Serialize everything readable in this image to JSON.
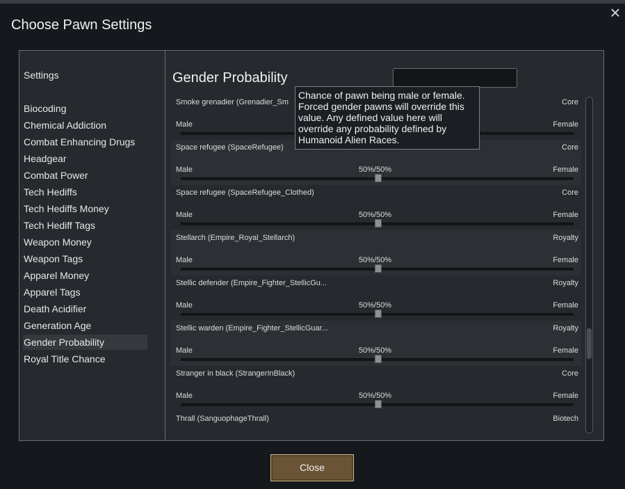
{
  "window": {
    "title": "Choose Pawn Settings",
    "close_icon": "×"
  },
  "sidebar": {
    "items": [
      {
        "label": "Settings"
      },
      {
        "label": "Biocoding"
      },
      {
        "label": "Chemical Addiction"
      },
      {
        "label": "Combat Enhancing Drugs"
      },
      {
        "label": "Headgear"
      },
      {
        "label": "Combat Power"
      },
      {
        "label": "Tech Hediffs"
      },
      {
        "label": "Tech Hediffs Money"
      },
      {
        "label": "Tech Hediff Tags"
      },
      {
        "label": "Weapon Money"
      },
      {
        "label": "Weapon Tags"
      },
      {
        "label": "Apparel Money"
      },
      {
        "label": "Apparel Tags"
      },
      {
        "label": "Death Acidifier"
      },
      {
        "label": "Generation Age"
      },
      {
        "label": "Gender Probability",
        "active": true
      },
      {
        "label": "Royal Title Chance"
      }
    ]
  },
  "main": {
    "title": "Gender Probability",
    "search": {
      "value": "",
      "placeholder": ""
    },
    "rows": [
      {
        "name": "Smoke grenadier (Grenadier_Sm",
        "source": "Core",
        "male": "Male",
        "pct": "",
        "female": "Female",
        "male_share": 0.5
      },
      {
        "name": "Space refugee (SpaceRefugee)",
        "source": "Core",
        "male": "Male",
        "pct": "50%/50%",
        "female": "Female",
        "male_share": 0.5
      },
      {
        "name": "Space refugee (SpaceRefugee_Clothed)",
        "source": "Core",
        "male": "Male",
        "pct": "50%/50%",
        "female": "Female",
        "male_share": 0.5
      },
      {
        "name": "Stellarch (Empire_Royal_Stellarch)",
        "source": "Royalty",
        "male": "Male",
        "pct": "50%/50%",
        "female": "Female",
        "male_share": 0.5
      },
      {
        "name": "Stellic defender (Empire_Fighter_StellicGu...",
        "source": "Royalty",
        "male": "Male",
        "pct": "50%/50%",
        "female": "Female",
        "male_share": 0.5
      },
      {
        "name": "Stellic warden (Empire_Fighter_StellicGuar...",
        "source": "Royalty",
        "male": "Male",
        "pct": "50%/50%",
        "female": "Female",
        "male_share": 0.5
      },
      {
        "name": "Stranger in black (StrangerInBlack)",
        "source": "Core",
        "male": "Male",
        "pct": "50%/50%",
        "female": "Female",
        "male_share": 0.5
      }
    ],
    "last_row": {
      "name": "Thrall (SanguophageThrall)",
      "source": "Biotech"
    }
  },
  "tooltip": {
    "text": "Chance of pawn being male or female.\nForced gender pawns will override this\nvalue. Any defined value here will\noverride any probability defined by\nHumanoid Alien Races."
  },
  "footer": {
    "close_label": "Close"
  },
  "colors": {
    "background": "#15191e",
    "panel": "#26292d",
    "row_alt": "#2c2f33",
    "close_button": "#6b5336"
  }
}
